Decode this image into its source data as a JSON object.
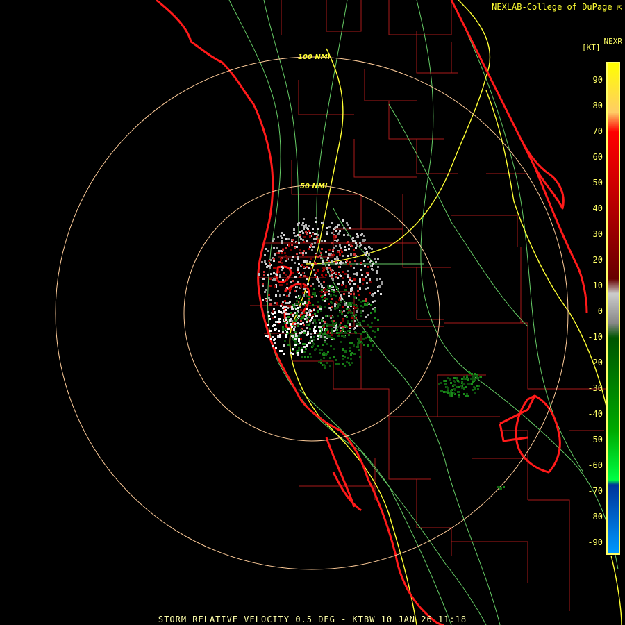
{
  "header": {
    "credit": "NEXLAB-College of DuPage ⇱"
  },
  "legend": {
    "product": "NEXR",
    "unit": "[KT]",
    "ticks": [
      "90",
      "80",
      "70",
      "60",
      "50",
      "40",
      "30",
      "20",
      "10",
      "0",
      "-10",
      "-20",
      "-30",
      "-40",
      "-50",
      "-60",
      "-70",
      "-80",
      "-90"
    ],
    "stops": [
      {
        "color": "#ffff00",
        "pos": 0
      },
      {
        "color": "#ffcc66",
        "pos": 0.1
      },
      {
        "color": "#ff0000",
        "pos": 0.14
      },
      {
        "color": "#cc0000",
        "pos": 0.25
      },
      {
        "color": "#660000",
        "pos": 0.44
      },
      {
        "color": "#cccccc",
        "pos": 0.47
      },
      {
        "color": "#888888",
        "pos": 0.53
      },
      {
        "color": "#005500",
        "pos": 0.56
      },
      {
        "color": "#00aa00",
        "pos": 0.75
      },
      {
        "color": "#00ff44",
        "pos": 0.85
      },
      {
        "color": "#003399",
        "pos": 0.86
      },
      {
        "color": "#0099ff",
        "pos": 1
      }
    ]
  },
  "rings": [
    {
      "label": "100 NMI"
    },
    {
      "label": "50 NMI"
    }
  ],
  "footer": {
    "caption": "STORM RELATIVE VELOCITY 0.5 DEG - KTBW 10 JAN 26 11:18"
  },
  "colors": {
    "coast": "#ff1a1a",
    "counties": "#aa1a1a",
    "roads": "#66cc66",
    "interstates": "#ffff33",
    "rings": "#ffcc99"
  }
}
